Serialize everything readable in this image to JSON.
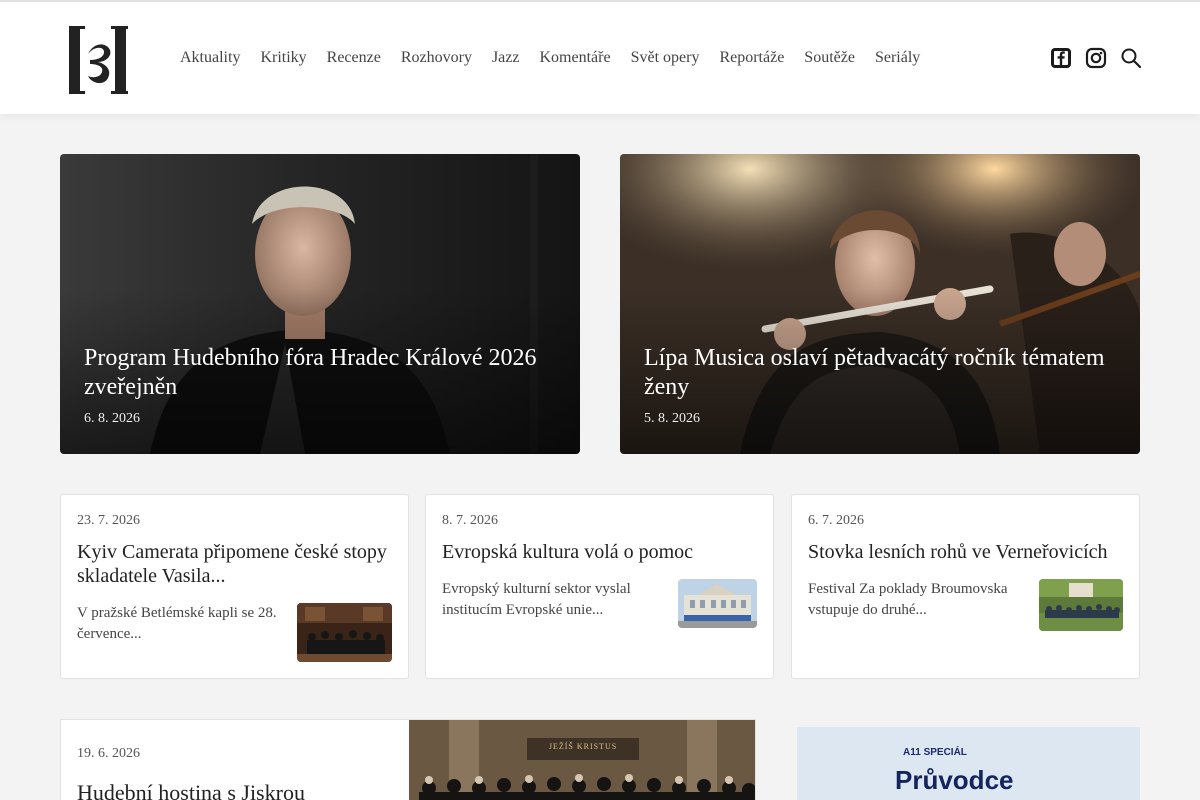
{
  "nav": [
    "Aktuality",
    "Kritiky",
    "Recenze",
    "Rozhovory",
    "Jazz",
    "Komentáře",
    "Svět opery",
    "Reportáže",
    "Soutěže",
    "Seriály"
  ],
  "social": [
    "facebook-icon",
    "instagram-icon",
    "search-icon"
  ],
  "hero": [
    {
      "title": "Program Hudebního fóra Hradec Králové 2026 zveřejněn",
      "date": "6. 8. 2026"
    },
    {
      "title": "Lípa Musica oslaví pětadvacátý ročník tématem ženy",
      "date": "5. 8. 2026"
    }
  ],
  "cards": [
    {
      "date": "23. 7. 2026",
      "title": "Kyiv Camerata připomene české stopy skladatele Vasila...",
      "excerpt": "V pražské Betlémské kapli se 28. července..."
    },
    {
      "date": "8. 7. 2026",
      "title": "Evropská kultura volá o pomoc",
      "excerpt": "Evropský kulturní sektor vyslal institucím Evropské unie..."
    },
    {
      "date": "6. 7. 2026",
      "title": "Stovka lesních rohů ve Verneřovicích",
      "excerpt": "Festival Za poklady Broumovska vstupuje do druhé..."
    }
  ],
  "wide": {
    "date": "19. 6. 2026",
    "title": "Hudební hostina s Jiskrou",
    "image_text": "JEŽÍŠ KRISTUS"
  },
  "ad": {
    "tag": "A11 SPECIÁL",
    "title": "Průvodce"
  }
}
